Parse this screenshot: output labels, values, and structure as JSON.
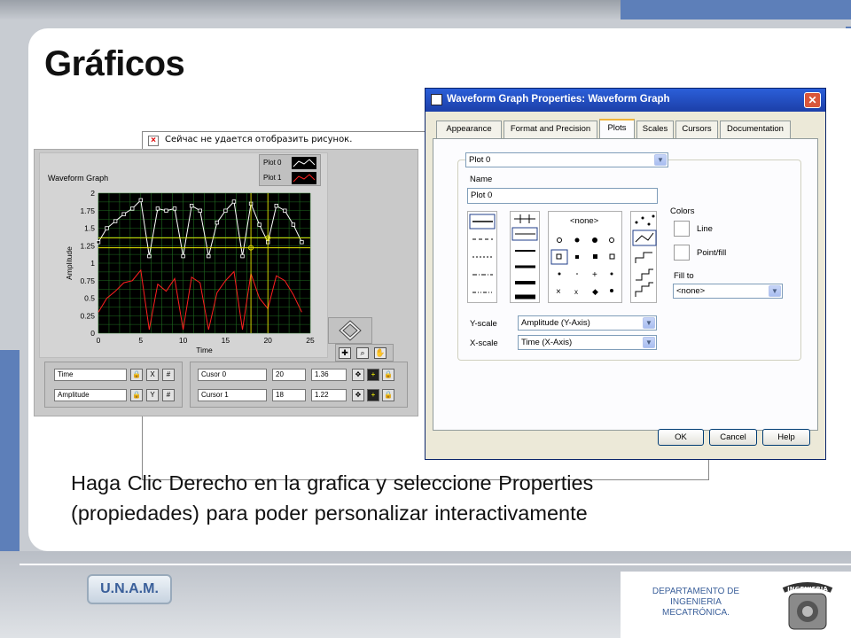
{
  "slide": {
    "title": "Gráficos",
    "caption_line1": "Haga Clic Derecho en la grafica y seleccione Properties",
    "caption_line2": "(propiedades) para poder personalizar interactivamente",
    "logo_text": "U.N.A.M.",
    "dept_line1": "DEPARTAMENTO DE",
    "dept_line2": "INGENIERIA",
    "dept_line3": "MECATRÓNICA.",
    "seal_text": "INGENIERIA"
  },
  "broken_image": {
    "text": "Сейчас не удается отобразить рисунок."
  },
  "graph": {
    "title": "Waveform Graph",
    "legend": [
      {
        "label": "Plot 0",
        "color": "#ffffff"
      },
      {
        "label": "Plot 1",
        "color": "#ff2020"
      }
    ],
    "scales": [
      {
        "name": "Time"
      },
      {
        "name": "Amplitude"
      }
    ],
    "cursors": [
      {
        "name": "Cusor 0",
        "x": "20",
        "y": "1.36"
      },
      {
        "name": "Cursor 1",
        "x": "18",
        "y": "1.22"
      }
    ],
    "chart_data": {
      "type": "line",
      "title": "Waveform Graph",
      "xlabel": "Time",
      "ylabel": "Amplitude",
      "xlim": [
        0,
        25
      ],
      "ylim": [
        0,
        2
      ],
      "x_ticks": [
        "0",
        "5",
        "10",
        "15",
        "20",
        "25"
      ],
      "y_ticks": [
        "0",
        "0.25",
        "0.5",
        "0.75",
        "1",
        "1.25",
        "1.5",
        "1.75",
        "2"
      ],
      "grid": true,
      "x": [
        0,
        1,
        2,
        3,
        4,
        5,
        6,
        7,
        8,
        9,
        10,
        11,
        12,
        13,
        14,
        15,
        16,
        17,
        18,
        19,
        20,
        21,
        22,
        23,
        24
      ],
      "series": [
        {
          "name": "Plot 0",
          "color": "#ffffff",
          "values": [
            1.3,
            1.5,
            1.6,
            1.7,
            1.78,
            1.9,
            1.1,
            1.78,
            1.75,
            1.78,
            1.1,
            1.82,
            1.75,
            1.1,
            1.58,
            1.75,
            1.88,
            1.1,
            1.85,
            1.55,
            1.3,
            1.82,
            1.75,
            1.55,
            1.3
          ]
        },
        {
          "name": "Plot 1",
          "color": "#ff2020",
          "values": [
            0.3,
            0.5,
            0.6,
            0.72,
            0.75,
            0.9,
            0.05,
            0.7,
            0.6,
            0.78,
            0.05,
            0.8,
            0.72,
            0.05,
            0.58,
            0.75,
            0.88,
            0.05,
            0.85,
            0.5,
            0.35,
            0.82,
            0.75,
            0.55,
            0.3
          ]
        }
      ],
      "cursors": [
        {
          "x": 20,
          "y": 1.36,
          "color": "#e8e800"
        },
        {
          "x": 18,
          "y": 1.22,
          "color": "#e8e800"
        }
      ]
    }
  },
  "dialog": {
    "title": "Waveform Graph Properties: Waveform Graph",
    "tabs": [
      "Appearance",
      "Format and Precision",
      "Plots",
      "Scales",
      "Cursors",
      "Documentation"
    ],
    "active_tab": "Plots",
    "plot_select": "Plot 0",
    "name_label": "Name",
    "name_value": "Plot 0",
    "point_none": "<none>",
    "colors_label": "Colors",
    "line_label": "Line",
    "pointfill_label": "Point/fill",
    "fillto_label": "Fill to",
    "fillto_value": "<none>",
    "yscale_label": "Y-scale",
    "yscale_value": "Amplitude (Y-Axis)",
    "xscale_label": "X-scale",
    "xscale_value": "Time (X-Axis)",
    "ok": "OK",
    "cancel": "Cancel",
    "help": "Help"
  }
}
